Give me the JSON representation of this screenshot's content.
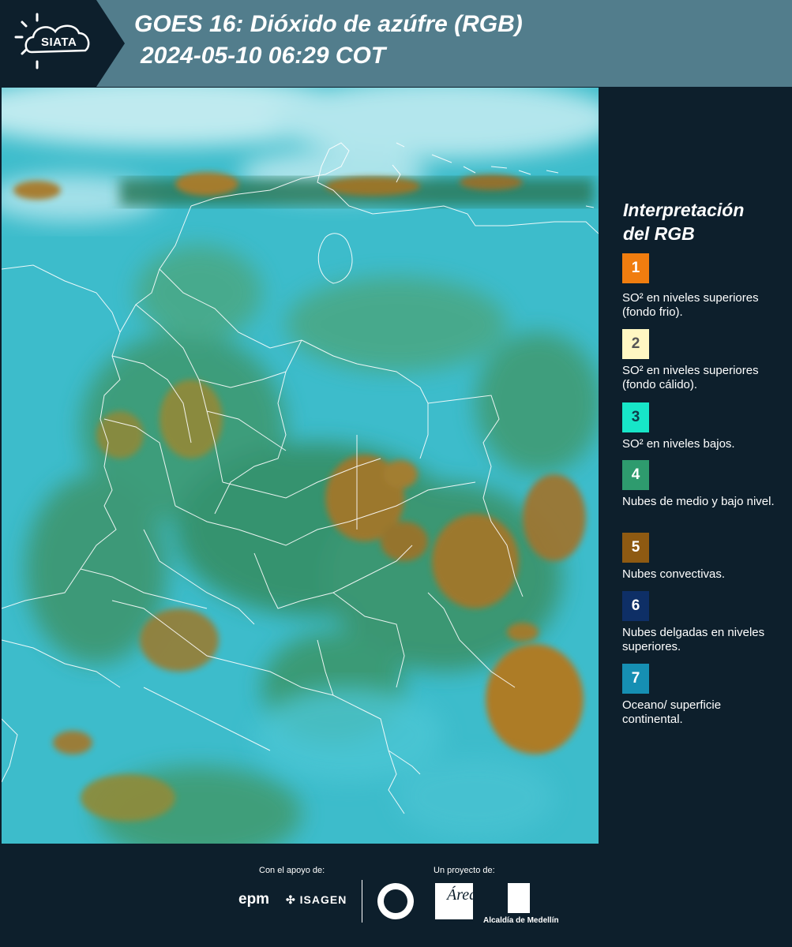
{
  "header": {
    "logo_text": "SIATA",
    "title_line1": "GOES 16: Dióxido de azúfre (RGB)",
    "title_line2": "2024-05-10 06:29 COT"
  },
  "legend": {
    "title_line1": "Interpretación",
    "title_line2": "del RGB",
    "items": [
      {
        "number": "1",
        "color": "#f07d0f",
        "text_color": "#ffffff",
        "label": "SO² en niveles superiores (fondo frio)."
      },
      {
        "number": "2",
        "color": "#fff7c2",
        "text_color": "#555555",
        "label": "SO² en niveles superiores (fondo cálido)."
      },
      {
        "number": "3",
        "color": "#17e6c8",
        "text_color": "#0d3b4a",
        "label": "SO² en niveles bajos."
      },
      {
        "number": "4",
        "color": "#2e9b6e",
        "text_color": "#ffffff",
        "label": "Nubes de medio y bajo nivel."
      },
      {
        "number": "5",
        "color": "#8e5a12",
        "text_color": "#ffffff",
        "label": "Nubes convectivas."
      },
      {
        "number": "6",
        "color": "#0e2f66",
        "text_color": "#ffffff",
        "label": "Nubes delgadas en niveles superiores."
      },
      {
        "number": "7",
        "color": "#168fb3",
        "text_color": "#ffffff",
        "label": "Oceano/ superficie continental."
      }
    ]
  },
  "footer": {
    "support_label": "Con el apoyo de:",
    "project_label": "Un proyecto de:",
    "epm": "epm",
    "isagen": "ISAGEN",
    "area_mark": "Área",
    "alcaldia": "Alcaldía de Medellín"
  }
}
